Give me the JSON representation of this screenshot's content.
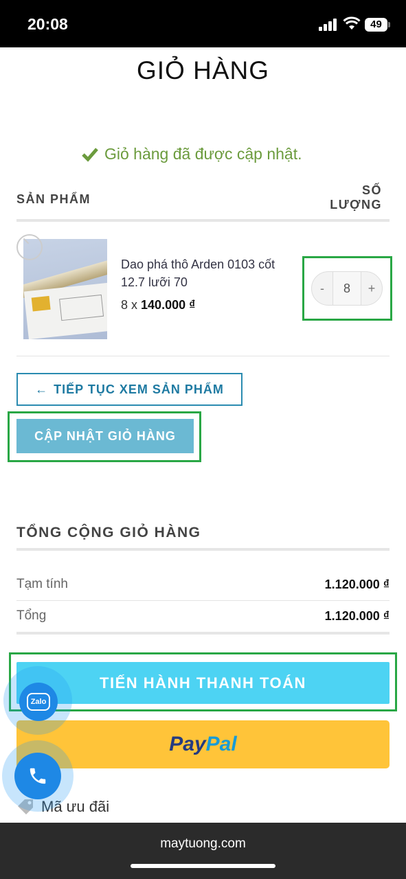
{
  "status_bar": {
    "time": "20:08",
    "battery": "49"
  },
  "page": {
    "title": "GIỎ HÀNG"
  },
  "notice": {
    "text": "Giỏ hàng đã được cập nhật.",
    "color": "#6b9b3d"
  },
  "cart_table": {
    "col_product": "SẢN PHẨM",
    "col_qty_line1": "SỐ",
    "col_qty_line2": "LƯỢNG",
    "items": [
      {
        "name": "Dao phá thô Arden 0103 cốt 12.7 lưỡi 70",
        "qty_prefix": "8 x",
        "unit_price": "140.000 ₫",
        "quantity": "8",
        "minus": "-",
        "plus": "+"
      }
    ]
  },
  "actions": {
    "continue_arrow": "←",
    "continue_label": "TIẾP TỤC XEM SẢN PHẨM",
    "update_label": "CẬP NHẬT GIỎ HÀNG"
  },
  "totals": {
    "title": "TỔNG CỘNG GIỎ HÀNG",
    "subtotal_label": "Tạm tính",
    "subtotal_value": "1.120.000 ₫",
    "total_label": "Tổng",
    "total_value": "1.120.000 ₫"
  },
  "checkout": {
    "label": "TIẾN HÀNH THANH TOÁN",
    "paypal_part1": "Pay",
    "paypal_part2": "Pal"
  },
  "coupon": {
    "label": "Mã ưu đãi"
  },
  "floating": {
    "zalo_label": "Zalo"
  },
  "browser": {
    "url": "maytuong.com"
  },
  "icons": {
    "notice": "check-icon",
    "remove": "remove-icon",
    "coupon": "tag-icon",
    "zalo": "zalo-icon",
    "phone": "phone-icon"
  },
  "colors": {
    "checkout_bg": "#4dd3f3",
    "update_bg": "#6bb9d3",
    "paypal_bg": "#ffc439",
    "highlight_border": "#29a745",
    "continue_border": "#2a8bb0"
  }
}
